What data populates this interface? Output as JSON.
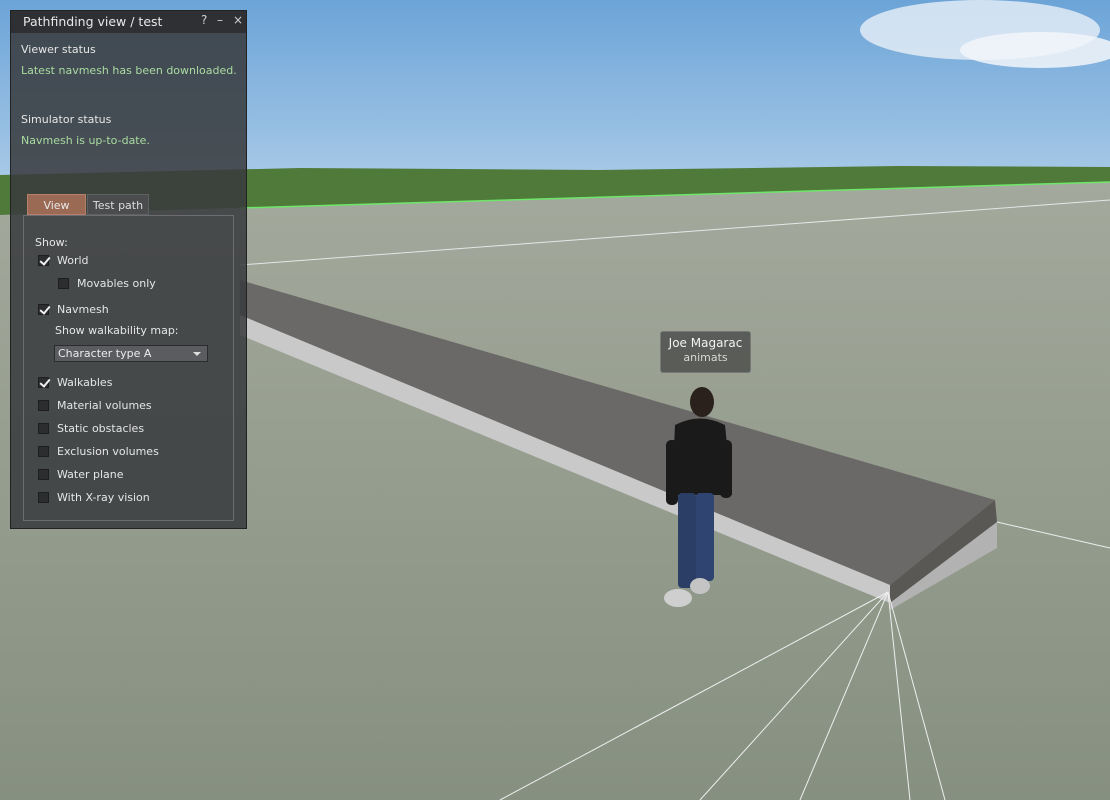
{
  "floater": {
    "title": "Pathfinding view / test",
    "help_glyph": "?",
    "minimize_glyph": "–",
    "close_glyph": "×",
    "viewer_status_label": "Viewer status",
    "viewer_status_text": "Latest navmesh has been downloaded.",
    "simulator_status_label": "Simulator status",
    "simulator_status_text": "Navmesh is up-to-date.",
    "tabs": [
      {
        "label": "View",
        "active": true
      },
      {
        "label": "Test path",
        "active": false
      }
    ],
    "view_panel": {
      "show_label": "Show:",
      "world": {
        "label": "World",
        "checked": true
      },
      "movables_only": {
        "label": "Movables only",
        "checked": false
      },
      "navmesh": {
        "label": "Navmesh",
        "checked": true
      },
      "walkability_label": "Show walkability map:",
      "character_type": "Character type A",
      "walkables": {
        "label": "Walkables",
        "checked": true
      },
      "material_volumes": {
        "label": "Material volumes",
        "checked": false
      },
      "static_obstacles": {
        "label": "Static obstacles",
        "checked": false
      },
      "exclusion_volumes": {
        "label": "Exclusion volumes",
        "checked": false
      },
      "water_plane": {
        "label": "Water plane",
        "checked": false
      },
      "xray_vision": {
        "label": "With X-ray vision",
        "checked": false
      }
    }
  },
  "avatar": {
    "name": "Joe Magarac",
    "group": "animats"
  },
  "colors": {
    "panel_bg": "#383a3c",
    "status_ok": "#a9dba0",
    "tab_active": "#9a6a55",
    "sky": "#7aaede",
    "ground": "#8d9588",
    "hills": "#4f7a3a"
  }
}
